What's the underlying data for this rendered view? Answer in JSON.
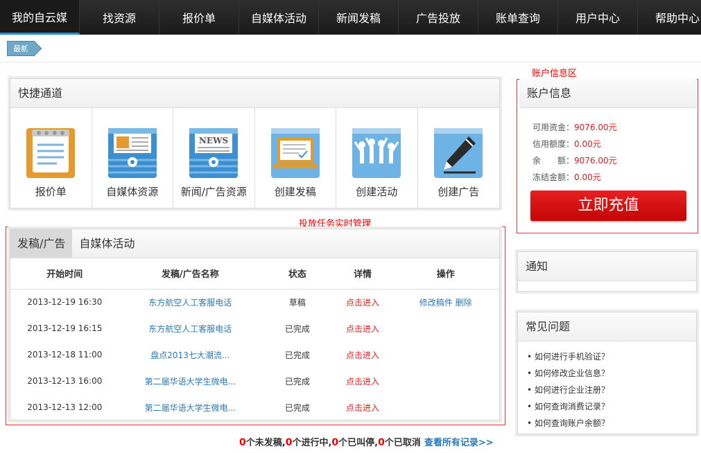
{
  "nav": {
    "items": [
      "我的自云媒",
      "找资源",
      "报价单",
      "自媒体活动",
      "新闻发稿",
      "广告投放",
      "账单查询",
      "用户中心",
      "帮助中心"
    ]
  },
  "breadcrumb": {
    "label": "最新"
  },
  "quick": {
    "title": "快捷通道",
    "items": [
      {
        "label": "报价单",
        "icon": "notepad-icon"
      },
      {
        "label": "自媒体资源",
        "icon": "media-resource-icon"
      },
      {
        "label": "新闻/广告资源",
        "icon": "news-icon"
      },
      {
        "label": "创建发稿",
        "icon": "laptop-check-icon"
      },
      {
        "label": "创建活动",
        "icon": "crowd-icon"
      },
      {
        "label": "创建广告",
        "icon": "pencil-icon"
      }
    ]
  },
  "annotations": {
    "account_area": "账户信息区",
    "task_area": "投放任务实时管理"
  },
  "tasks": {
    "tabs": [
      "发稿/广告",
      "自媒体活动"
    ],
    "columns": [
      "开始时间",
      "发稿/广告名称",
      "状态",
      "详情",
      "操作"
    ],
    "rows": [
      {
        "time": "2013-12-19 16:30",
        "name": "东方航空人工客服电话",
        "status": "草稿",
        "detail": "点击进入",
        "ops": "修改稿件 删除"
      },
      {
        "time": "2013-12-19 16:15",
        "name": "东方航空人工客服电话",
        "status": "已完成",
        "detail": "点击进入",
        "ops": ""
      },
      {
        "time": "2013-12-18 11:00",
        "name": "盘点2013七大潮流...",
        "status": "已完成",
        "detail": "点击进入",
        "ops": ""
      },
      {
        "time": "2013-12-13 16:00",
        "name": "第二届华语大学生微电...",
        "status": "已完成",
        "detail": "点击进入",
        "ops": ""
      },
      {
        "time": "2013-12-13 12:00",
        "name": "第二届华语大学生微电...",
        "status": "已完成",
        "detail": "点击进入",
        "ops": ""
      }
    ]
  },
  "summary": {
    "unsent": "0",
    "unsent_label": "个未发稿,",
    "running": "0",
    "running_label": "个进行中,",
    "paused": "0",
    "paused_label": "个已叫停,",
    "cancelled": "0",
    "cancelled_label": "个已取消",
    "view_all": "查看所有记录>>"
  },
  "account": {
    "title": "账户信息",
    "available_label": "可用资金：",
    "available": "9076.00元",
    "credit_label": "信用额度：",
    "credit": "0.00元",
    "balance_label": "余　　额：",
    "balance": "9076.00元",
    "frozen_label": "冻结金额：",
    "frozen": "0.00元",
    "recharge": "立即充值"
  },
  "notice": {
    "title": "通知"
  },
  "faq": {
    "title": "常见问题",
    "items": [
      "• 如何进行手机验证？",
      "• 如何修改企业信息？",
      "• 如何进行企业注册？",
      "• 如何查询消费记录？",
      "• 如何查询账户余额？"
    ]
  },
  "colors": {
    "accent": "#1a8fd6",
    "danger": "#e00000",
    "link": "#2979b8"
  }
}
